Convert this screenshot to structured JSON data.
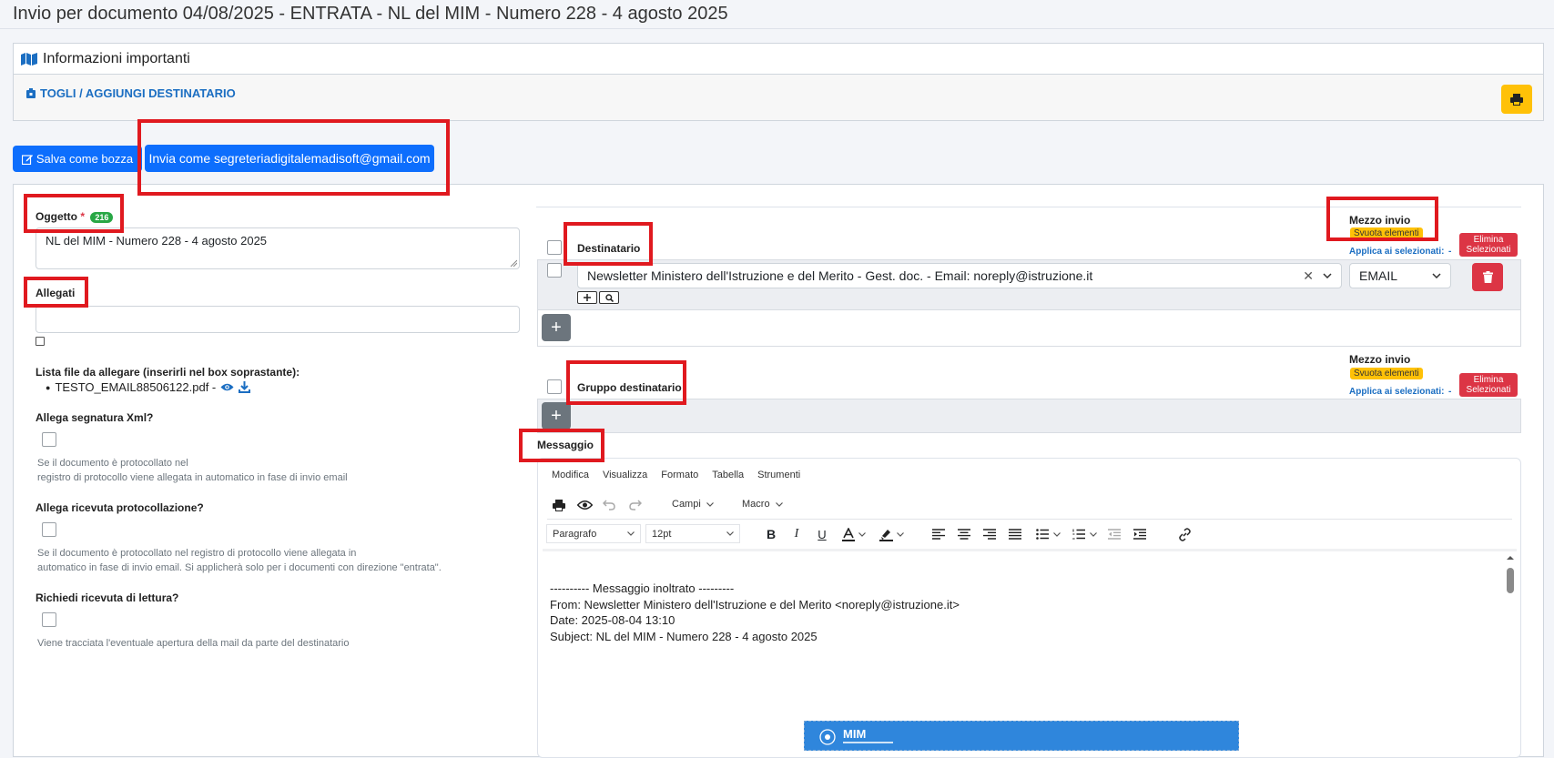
{
  "page": {
    "title": "Invio per documento 04/08/2025 - ENTRATA - NL del MIM - Numero 228 - 4 agosto 2025"
  },
  "info": {
    "title": "Informazioni importanti",
    "link": "TOGLI / AGGIUNGI DESTINATARIO"
  },
  "actions": {
    "save_draft": "Salva come bozza",
    "send_as": "Invia come segreteriadigitalemadisoft@gmail.com"
  },
  "form": {
    "subject_label": "Oggetto",
    "required_mark": "*",
    "subject_counter": "216",
    "subject_value": "NL del MIM - Numero 228 - 4 agosto 2025",
    "attachments_label": "Allegati",
    "file_list_label": "Lista file da allegare (inserirli nel box soprastante):",
    "file_name": "TESTO_EMAIL88506122.pdf -",
    "xml_sign_label": "Allega segnatura Xml?",
    "xml_sign_help_1": "Se il documento è protocollato nel",
    "xml_sign_help_2": "registro di protocollo viene allegata in automatico in fase di invio email",
    "receipt_label": "Allega ricevuta protocollazione?",
    "receipt_help_1": "Se il documento è protocollato nel registro di protocollo viene allegata in",
    "receipt_help_2": "automatico in fase di invio email. Si applicherà solo per i documenti con direzione \"entrata\".",
    "read_label": "Richiedi ricevuta di lettura?",
    "read_help": "Viene tracciata l'eventuale apertura della mail da parte del destinatario"
  },
  "recipients": {
    "header": "Destinatario",
    "mezzo_label": "Mezzo invio",
    "clear_badge": "Svuota elementi",
    "apply_label": "Applica ai selezionati:",
    "apply_dash": "-",
    "delete_selected_1": "Elimina",
    "delete_selected_2": "Selezionati",
    "row_value": "Newsletter Ministero dell'Istruzione e del Merito - Gest. doc. - Email: noreply@istruzione.it",
    "clear_x": "✕",
    "row_medium": "EMAIL",
    "add": "+"
  },
  "groups": {
    "header": "Gruppo destinatario",
    "mezzo_label": "Mezzo invio",
    "clear_badge": "Svuota elementi",
    "apply_label": "Applica ai selezionati:",
    "apply_dash": "-",
    "delete_selected_1": "Elimina",
    "delete_selected_2": "Selezionati",
    "add": "+"
  },
  "message": {
    "label": "Messaggio",
    "menu": [
      "Modifica",
      "Visualizza",
      "Formato",
      "Tabella",
      "Strumenti"
    ],
    "campi": "Campi",
    "macro": "Macro",
    "block_format": "Paragrafo",
    "font_size": "12pt",
    "lines": [
      "---------- Messaggio inoltrato ---------",
      "From: Newsletter Ministero dell'Istruzione e del Merito <noreply@istruzione.it>",
      "Date: 2025-08-04 13:10",
      "Subject: NL del MIM - Numero 228 - 4 agosto 2025"
    ],
    "banner_text": "MIM"
  },
  "colors": {
    "primary": "#0d6efd",
    "warning": "#ffc107",
    "danger": "#dc3545",
    "success": "#28a745",
    "highlight": "#e0191f"
  }
}
